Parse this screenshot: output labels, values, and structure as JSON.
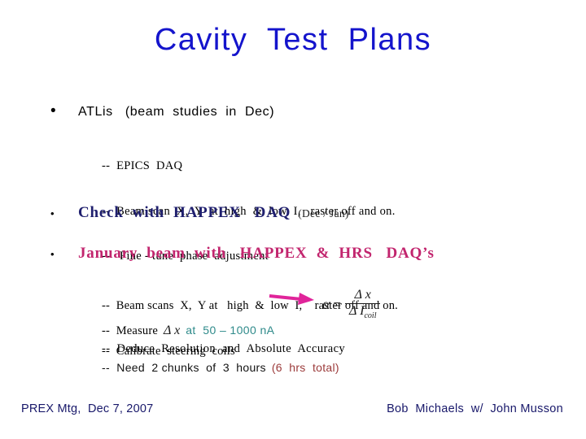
{
  "slide": {
    "title": "Cavity  Test  Plans",
    "background_color": "#ffffff",
    "title_color": "#1414CC"
  },
  "bullets": [
    {
      "marker": "•",
      "text": "ATLis   (beam  studies  in  Dec)",
      "color": "#000000",
      "subitems": [
        "--  EPICS  DAQ",
        "--  Beam scan  X,  Y  at  high  &  low  I,   raster off and on.",
        "--   Fine - tune  phase  adjustment"
      ]
    },
    {
      "marker": "•",
      "text": "Check  with  HAPPEX   DAQ",
      "annotation": "(Dec /  Jan)",
      "color": "#1F1F6E"
    },
    {
      "marker": "•",
      "text": "January  beam  with   HAPPEX  &  HRS   DAQ’s",
      "color": "#C2256E",
      "subitems": [
        "--  Beam scans  X,  Y at   high  &  low  I,    raster off and on.",
        "--  Calibrate  steering  coils"
      ]
    }
  ],
  "formula": {
    "lhs": "α",
    "equals": "=",
    "numerator": "Δ x",
    "denominator": "Δ I",
    "denominator_subscript": "coil",
    "arrow_color": "#E0249A"
  },
  "measure_line": {
    "prefix": "--  Measure",
    "symbol": "Δ x",
    "range_text": "at  50 – 1000 nA",
    "range_color": "#2E8A8A"
  },
  "deduce_line": {
    "text": "--  Deduce  Resolution  and  Absolute  Accuracy"
  },
  "need_line": {
    "text": "--  Need  2 chunks  of  3  hours",
    "note": "(6  hrs  total)",
    "note_color": "#9B3A3A"
  },
  "footer": {
    "left": "PREX Mtg,  Dec 7, 2007",
    "right": "Bob  Michaels  w/  John Musson",
    "color": "#18186A"
  }
}
